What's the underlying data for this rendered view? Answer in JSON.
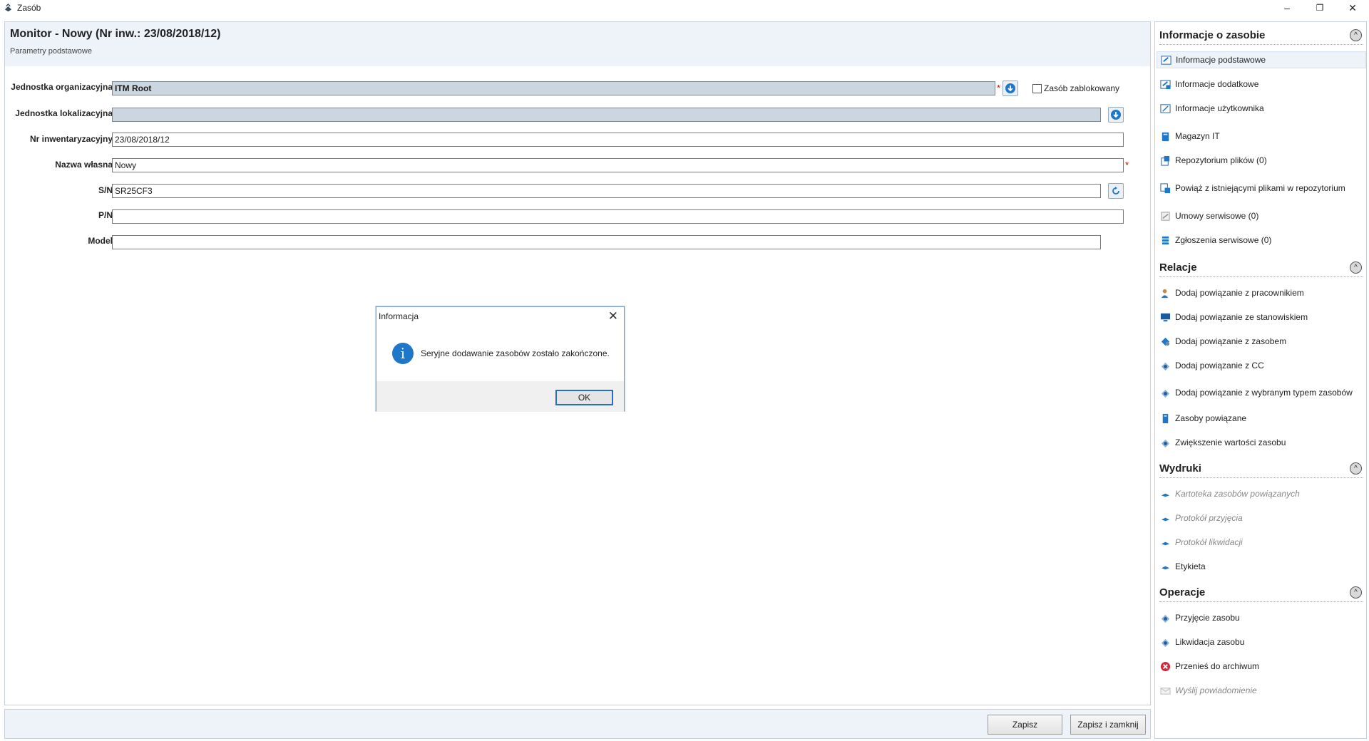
{
  "window": {
    "title": "Zasób",
    "minimize_glyph": "–",
    "restore_glyph": "❐",
    "close_glyph": "✕"
  },
  "header": {
    "title": "Monitor - Nowy (Nr inw.: 23/08/2018/12)",
    "subtitle": "Parametry podstawowe"
  },
  "form": {
    "org_unit": {
      "label": "Jednostka organizacyjna",
      "value": "ITM Root"
    },
    "loc_unit": {
      "label": "Jednostka lokalizacyjna",
      "value": ""
    },
    "inv_no": {
      "label": "Nr inwentaryzacyjny",
      "value": "23/08/2018/12"
    },
    "own_name": {
      "label": "Nazwa własna",
      "value": "Nowy"
    },
    "sn": {
      "label": "S/N",
      "value": "SR25CF3"
    },
    "pn": {
      "label": "P/N",
      "value": ""
    },
    "model": {
      "label": "Model",
      "value": ""
    },
    "blocked": {
      "label": "Zasób zablokowany",
      "checked": false
    },
    "required_mark": "*"
  },
  "bottom": {
    "save_label": "Zapisz",
    "save_close_label": "Zapisz i zamknij"
  },
  "sidebar": {
    "collapse_glyph": "^",
    "sections": [
      {
        "title": "Informacje o zasobie"
      },
      {
        "title": "Relacje"
      },
      {
        "title": "Wydruki"
      },
      {
        "title": "Operacje"
      }
    ],
    "info_items": [
      {
        "label": "Informacje podstawowe",
        "icon": "form-icon"
      },
      {
        "label": "Informacje dodatkowe",
        "icon": "form-plus-icon"
      },
      {
        "label": "Informacje użytkownika",
        "icon": "pencil-icon"
      },
      {
        "label": "Magazyn IT",
        "icon": "warehouse-icon"
      },
      {
        "label": "Repozytorium plików (0)",
        "icon": "files-icon"
      },
      {
        "label": "Powiąż z istniejącymi plikami w repozytorium",
        "icon": "link-files-icon"
      },
      {
        "label": "Umowy serwisowe (0)",
        "icon": "contract-icon"
      },
      {
        "label": "Zgłoszenia serwisowe (0)",
        "icon": "tickets-icon"
      }
    ],
    "relations_items": [
      {
        "label": "Dodaj powiązanie z pracownikiem",
        "icon": "user-link-icon"
      },
      {
        "label": "Dodaj powiązanie ze stanowiskiem",
        "icon": "workstation-link-icon"
      },
      {
        "label": "Dodaj powiązanie z zasobem",
        "icon": "asset-link-icon"
      },
      {
        "label": "Dodaj powiązanie z CC",
        "icon": "cc-link-icon"
      },
      {
        "label": "Dodaj powiązanie z wybranym typem zasobów",
        "icon": "type-link-icon"
      },
      {
        "label": "Zasoby powiązane",
        "icon": "related-assets-icon"
      },
      {
        "label": "Zwiększenie wartości zasobu",
        "icon": "value-increase-icon"
      }
    ],
    "prints_items": [
      {
        "label": "Kartoteka zasobów powiązanych",
        "icon": "print-icon",
        "disabled": true
      },
      {
        "label": "Protokół przyjęcia",
        "icon": "print-icon",
        "disabled": true
      },
      {
        "label": "Protokół likwidacji",
        "icon": "print-icon",
        "disabled": true
      },
      {
        "label": "Etykieta",
        "icon": "print-icon",
        "disabled": false
      }
    ],
    "operations_items": [
      {
        "label": "Przyjęcie zasobu",
        "icon": "receive-icon",
        "disabled": false
      },
      {
        "label": "Likwidacja zasobu",
        "icon": "dispose-icon",
        "disabled": false
      },
      {
        "label": "Przenieś do archiwum",
        "icon": "archive-x-icon",
        "disabled": false
      },
      {
        "label": "Wyślij powiadomienie",
        "icon": "mail-icon",
        "disabled": true
      }
    ]
  },
  "dialog": {
    "title": "Informacja",
    "close_glyph": "✕",
    "icon_glyph": "i",
    "message": "Seryjne dodawanie zasobów zostało zakończone.",
    "ok_label": "OK"
  },
  "colors": {
    "accent": "#1e77c8",
    "required": "#dd0000",
    "panel_header": "#eef3f9",
    "readonly_field": "#ccd6e0"
  }
}
